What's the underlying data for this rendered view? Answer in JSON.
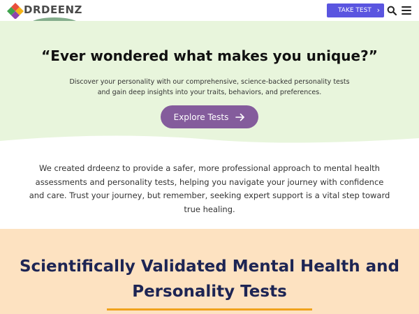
{
  "header": {
    "logo_text": "DRDEENZ",
    "take_test_label": "TAKE TEST",
    "icons": {
      "take_test": "chevron-right-icon",
      "search": "search-icon",
      "menu": "hamburger-menu-icon"
    }
  },
  "hero": {
    "title": "“Ever wondered what makes you unique?”",
    "subtitle": "Discover your personality with our comprehensive, science-backed personality tests and gain deep insights into your traits, behaviors, and preferences.",
    "button_label": "Explore Tests",
    "button_icon": "arrow-right-icon"
  },
  "about": {
    "text": "We created drdeenz to provide a safer, more professional approach to mental health assessments and personality tests, helping you navigate your journey with confidence and care. Trust your journey, but remember, seeking expert support is a vital step toward true healing."
  },
  "section": {
    "title": "Scientifically Validated Mental Health and Personality Tests"
  },
  "colors": {
    "hero_background": "#e8f5dc",
    "primary_button": "#5a55e0",
    "explore_button": "#845c9c",
    "section_background": "#fde2c1",
    "section_title": "#1d2554",
    "underline_accent": "#f0a21c"
  }
}
